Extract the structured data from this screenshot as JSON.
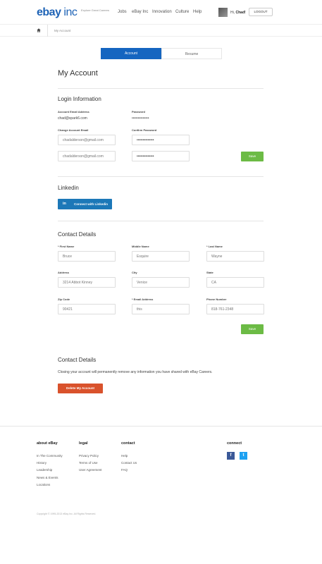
{
  "header": {
    "logo_main": "ebay",
    "logo_inc": "inc",
    "tagline": "Explore Great Careers",
    "nav": [
      "Jobs",
      "eBay Inc",
      "Innovation",
      "Culture",
      "Help"
    ],
    "greeting": "Hi,",
    "user_name": "Chad!",
    "logout_label": "LOGOUT"
  },
  "breadcrumb": {
    "current": "My Account"
  },
  "tabs": {
    "account": "Account",
    "resume": "Resume"
  },
  "page_title": "My Account",
  "login": {
    "title": "Login Information",
    "email_label": "Account Email Address",
    "email_value": "chad@spark6.com",
    "password_label": "Password",
    "password_value": "••••••••••••••",
    "change_email_label": "Change Account Email",
    "change_email_placeholder": "chadalderson@gmail.com",
    "change_email_confirm_placeholder": "chadalderson@gmail.com",
    "confirm_password_label": "Confirm Password",
    "password_field_value": "••••••••••••••",
    "password_confirm_value": "••••••••••••••",
    "save_label": "Save"
  },
  "linkedin": {
    "title": "Linkedin",
    "button_icon": "in",
    "button_label": "Connect with Linkedin"
  },
  "contact": {
    "title": "Contact Details",
    "first_name_label": "* First Name",
    "first_name_value": "Bruce",
    "middle_name_label": "Middle Name",
    "middle_name_value": "Esquire",
    "last_name_label": "* Last Name",
    "last_name_value": "Wayne",
    "address_label": "Address",
    "address_value": "3214 Abbot Kinney",
    "city_label": "City",
    "city_value": "Venice",
    "state_label": "State",
    "state_value": "CA",
    "zip_label": "Zip Code",
    "zip_value": "90421",
    "email_label": "* Email Address",
    "email_value": "this",
    "phone_label": "Phone Number",
    "phone_value": "818-761-2348",
    "save_label": "Save"
  },
  "delete": {
    "title": "Contact Details",
    "text": "Closing your account will permanently remove any information you have shared with eBay Careers.",
    "button_label": "Delete My Account"
  },
  "footer": {
    "about_title": "about eBay",
    "about_links": [
      "In The Community",
      "History",
      "Leadership",
      "News & Events",
      "Locations"
    ],
    "legal_title": "legal",
    "legal_links": [
      "Privacy Policy",
      "Terms of Use",
      "User Agreement"
    ],
    "contact_title": "contact",
    "contact_links": [
      "Help",
      "Contact Us",
      "FAQ"
    ],
    "connect_title": "connect",
    "facebook_glyph": "f",
    "twitter_glyph": "t",
    "copyright": "Copyright © 1995-2013 eBay Inc. All Rights Reserved."
  },
  "colors": {
    "brand_blue": "#1565c0",
    "save_green": "#6cbb45",
    "delete_red": "#d9522c",
    "linkedin_blue": "#1c78b8",
    "facebook_blue": "#3b5998",
    "twitter_blue": "#1da1f2"
  }
}
